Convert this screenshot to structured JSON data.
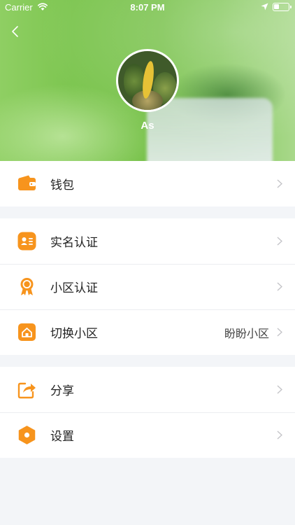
{
  "status_bar": {
    "carrier": "Carrier",
    "time": "8:07 PM",
    "wifi_icon": "wifi-icon",
    "location_icon": "location-arrow-icon",
    "battery_icon": "battery-icon",
    "battery_level": 0.35
  },
  "header": {
    "back_icon": "chevron-left-icon",
    "username": "As"
  },
  "menu": {
    "wallet": {
      "label": "钱包",
      "icon": "wallet-icon"
    },
    "real_name": {
      "label": "实名认证",
      "icon": "id-card-icon"
    },
    "community_cert": {
      "label": "小区认证",
      "icon": "award-badge-icon"
    },
    "switch_community": {
      "label": "切换小区",
      "value": "盼盼小区",
      "icon": "home-icon"
    },
    "share": {
      "label": "分享",
      "icon": "share-icon"
    },
    "settings": {
      "label": "设置",
      "icon": "hexagon-settings-icon"
    }
  },
  "colors": {
    "accent": "#f7941d",
    "chevron": "#c4c4c8",
    "background": "#f3f5f8"
  }
}
